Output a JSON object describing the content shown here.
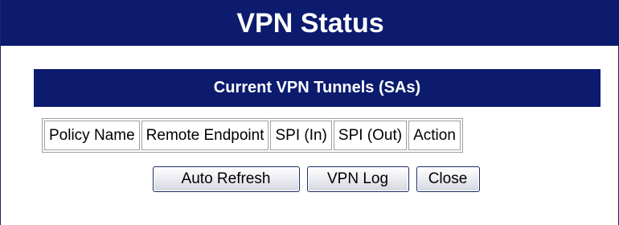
{
  "header": {
    "title": "VPN Status"
  },
  "section": {
    "title": "Current VPN Tunnels (SAs)"
  },
  "table": {
    "columns": [
      "Policy Name",
      "Remote Endpoint",
      "SPI (In)",
      "SPI (Out)",
      "Action"
    ]
  },
  "buttons": {
    "auto_refresh": "Auto Refresh",
    "vpn_log": "VPN Log",
    "close": "Close"
  },
  "colors": {
    "header_bg": "#0c1b6e",
    "header_text": "#ffffff"
  }
}
